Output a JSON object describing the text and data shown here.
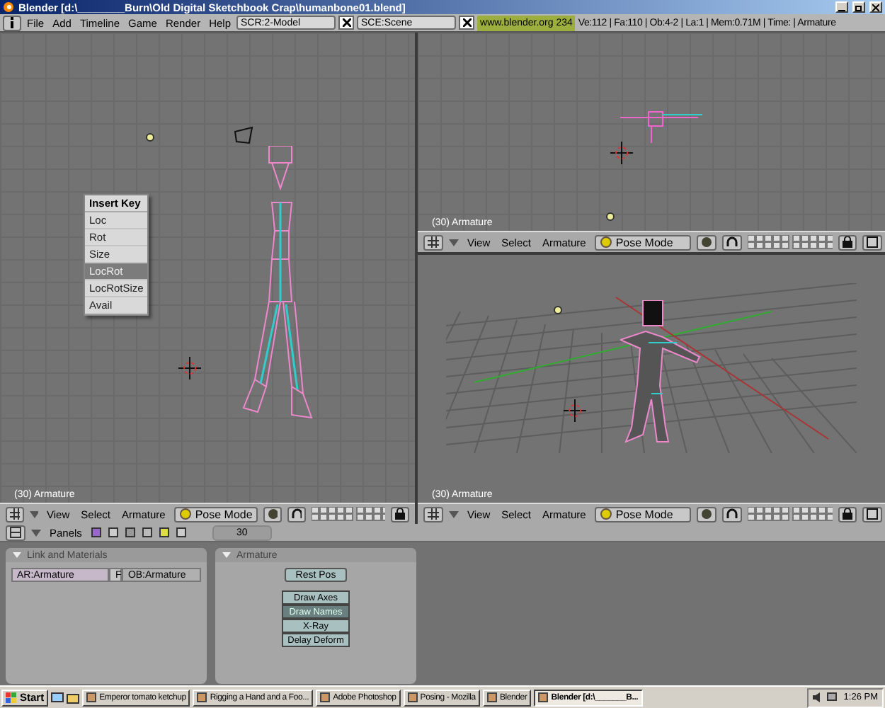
{
  "window": {
    "title": "Blender [d:\\________Burn\\Old Digital Sketchbook Crap\\humanbone01.blend]"
  },
  "menu_bar": {
    "menus": [
      "File",
      "Add",
      "Timeline",
      "Game",
      "Render",
      "Help"
    ],
    "screen": "SCR:2-Model",
    "scene": "SCE:Scene",
    "site": "www.blender.org 234",
    "stats": "Ve:112 | Fa:110 | Ob:4-2 | La:1 | Mem:0.71M | Time: | Armature"
  },
  "viewports": [
    {
      "kind": "front",
      "label": "(30) Armature",
      "menus": [
        "View",
        "Select",
        "Armature"
      ],
      "mode": "Pose Mode"
    },
    {
      "kind": "top",
      "label": "(30) Armature",
      "menus": [
        "View",
        "Select",
        "Armature"
      ],
      "mode": "Pose Mode"
    },
    {
      "kind": "perspective",
      "label": "(30) Armature",
      "menus": [
        "View",
        "Select",
        "Armature"
      ],
      "mode": "Pose Mode"
    }
  ],
  "insert_key_menu": {
    "title": "Insert Key",
    "items": [
      {
        "label": "Loc",
        "selected": false
      },
      {
        "label": "Rot",
        "selected": false
      },
      {
        "label": "Size",
        "selected": false
      },
      {
        "label": "LocRot",
        "selected": true
      },
      {
        "label": "LocRotSize",
        "selected": false
      },
      {
        "label": "Avail",
        "selected": false
      }
    ]
  },
  "buttons_window": {
    "panels_label": "Panels",
    "frame": "30",
    "link_panel": {
      "title": "Link and Materials",
      "armature": "AR:Armature",
      "fake": "F",
      "object": "OB:Armature"
    },
    "armature_panel": {
      "title": "Armature",
      "rest_pos": "Rest Pos",
      "toggles": [
        {
          "label": "Draw Axes",
          "on": false
        },
        {
          "label": "Draw Names",
          "on": true
        },
        {
          "label": "X-Ray",
          "on": false
        },
        {
          "label": "Delay Deform",
          "on": false
        }
      ]
    }
  },
  "taskbar": {
    "start": "Start",
    "tasks": [
      {
        "label": "Emperor tomato ketchup",
        "selected": false
      },
      {
        "label": "Rigging a Hand and a Foo...",
        "selected": false
      },
      {
        "label": "Adobe Photoshop",
        "selected": false
      },
      {
        "label": "Posing - Mozilla",
        "selected": false
      },
      {
        "label": "Blender",
        "selected": false
      },
      {
        "label": "Blender [d:\\_______B...",
        "selected": true
      }
    ],
    "clock": "1:26 PM"
  }
}
